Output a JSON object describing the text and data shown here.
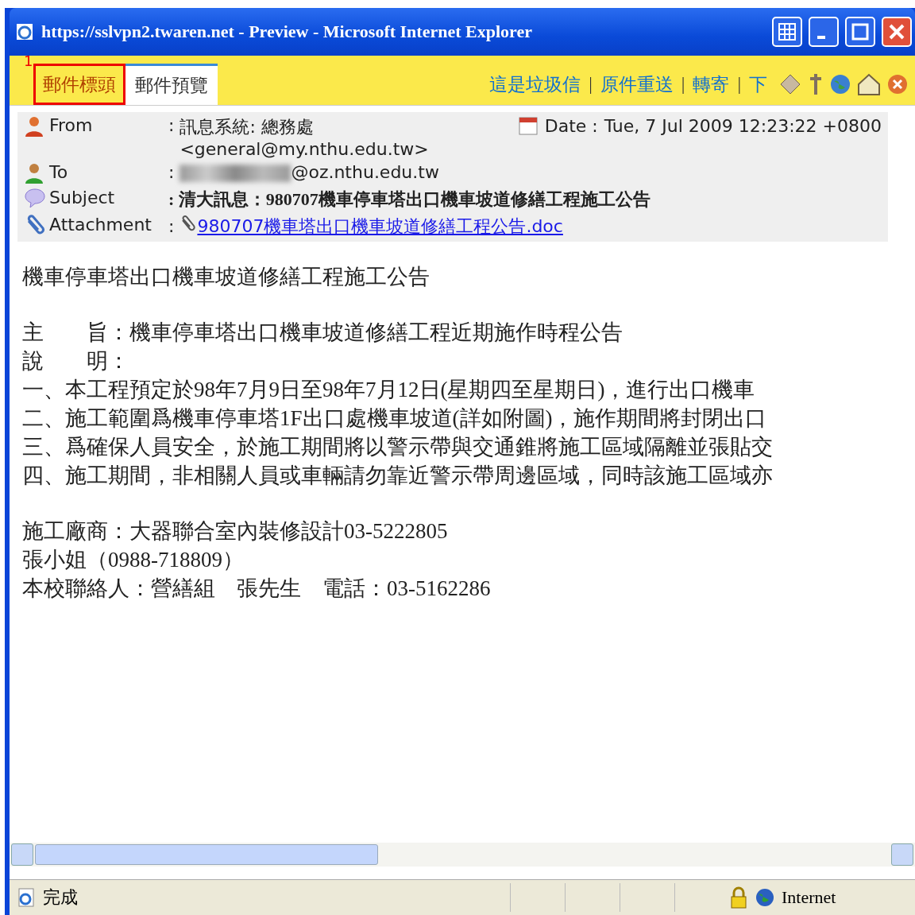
{
  "window": {
    "title": "https://sslvpn2.twaren.net - Preview - Microsoft Internet Explorer"
  },
  "annotation": {
    "label": "1"
  },
  "tabs": [
    {
      "label": "郵件標頭",
      "selected": false,
      "highlighted": true
    },
    {
      "label": "郵件預覽",
      "selected": true,
      "highlighted": false
    }
  ],
  "links": [
    {
      "label": "這是垃圾信"
    },
    {
      "separator": "|",
      "label": "原件重送"
    },
    {
      "separator": "|",
      "label": "轉寄"
    },
    {
      "separator": "|",
      "label": "下"
    }
  ],
  "header": {
    "fields": [
      {
        "kind": "from",
        "label": "From",
        "colon": ":",
        "value": "訊息系統: 總務處",
        "value_line2": "<general@my.nthu.edu.tw>"
      },
      {
        "kind": "to",
        "label": "To",
        "colon": ":",
        "value": "@oz.nthu.edu.tw"
      },
      {
        "kind": "subject",
        "label": "Subject",
        "colon": ":",
        "value": "清大訊息：980707機車停車塔出口機車坡道修繕工程施工公告"
      },
      {
        "kind": "attachment",
        "label": "Attachment",
        "colon": ":",
        "value": "980707機車塔出口機車坡道修繕工程公告.doc"
      }
    ],
    "date_label": "Date :",
    "date": "Tue, 7 Jul 2009 12:23:22 +0800"
  },
  "body": {
    "paragraphs": [
      [
        "機車停車塔出口機車坡道修繕工程施工公告"
      ],
      [
        "主　　旨：機車停車塔出口機車坡道修繕工程近期施作時程公告",
        "說　　明：",
        "一、本工程預定於98年7月9日至98年7月12日(星期四至星期日)，進行出口機車",
        "二、施工範圍爲機車停車塔1F出口處機車坡道(詳如附圖)，施作期間將封閉出口",
        "三、爲確保人員安全，於施工期間將以警示帶與交通錐將施工區域隔離並張貼交",
        "四、施工期間，非相關人員或車輛請勿靠近警示帶周邊區域，同時該施工區域亦"
      ],
      [
        "施工廠商：大器聯合室內裝修設計03-5222805",
        "張小姐（0988-718809）",
        "本校聯絡人：營繕組　張先生　電話：03-5162286"
      ]
    ]
  },
  "status_bar": {
    "text": "完成",
    "zone": "Internet"
  }
}
